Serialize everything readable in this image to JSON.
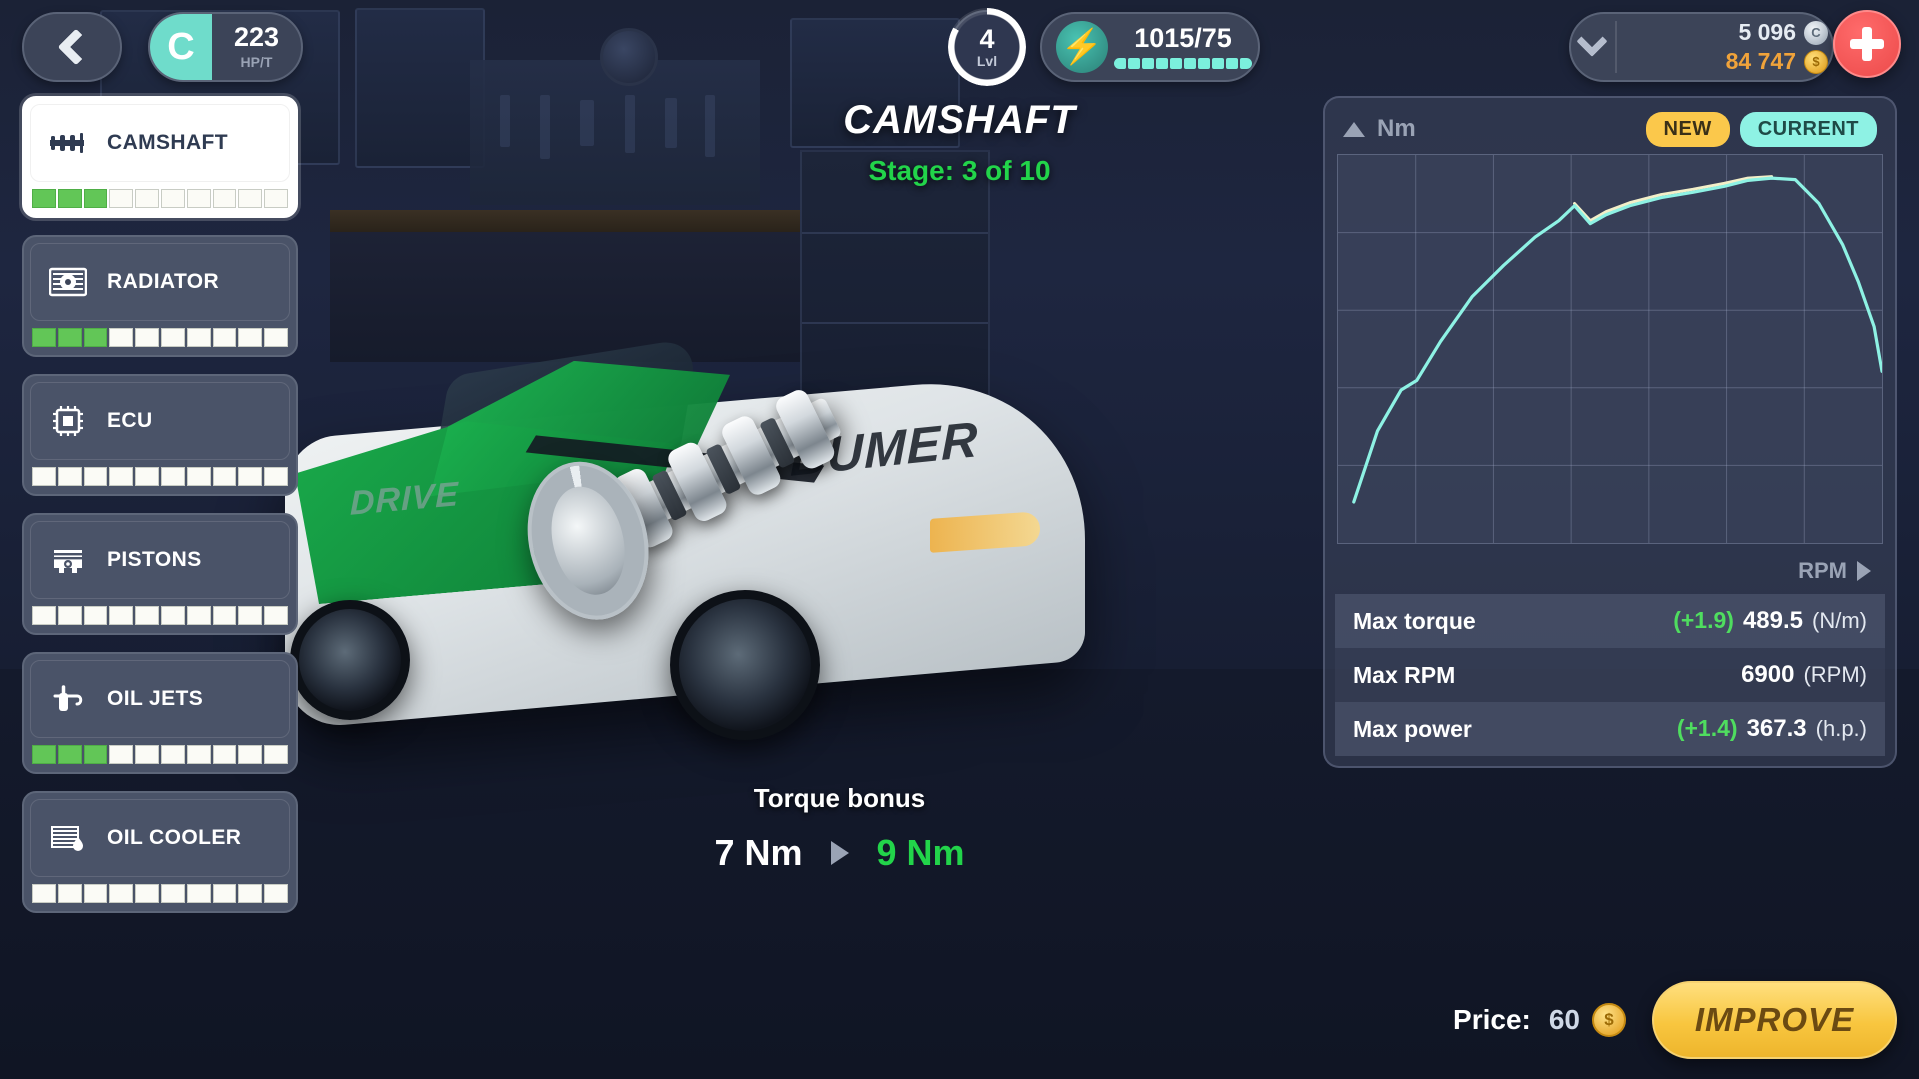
{
  "hud": {
    "back_icon": "chevron-left-icon",
    "class_letter": "C",
    "class_value": "223",
    "class_unit": "HP/T",
    "level_value": "4",
    "level_label": "Lvl",
    "energy_icon": "lightning-bolt-icon",
    "energy_value": "1015/75",
    "energy_segments_total": 10,
    "energy_segments_filled": 10,
    "silver_amount": "5 096",
    "gold_amount": "84 747",
    "add_icon": "plus-icon",
    "expand_icon": "chevron-down-icon"
  },
  "parts": [
    {
      "label": "CAMSHAFT",
      "icon": "camshaft-icon",
      "active": true,
      "level": 3,
      "max": 10
    },
    {
      "label": "RADIATOR",
      "icon": "radiator-icon",
      "active": false,
      "level": 3,
      "max": 10
    },
    {
      "label": "ECU",
      "icon": "ecu-chip-icon",
      "active": false,
      "level": 0,
      "max": 10
    },
    {
      "label": "PISTONS",
      "icon": "piston-icon",
      "active": false,
      "level": 0,
      "max": 10
    },
    {
      "label": "OIL JETS",
      "icon": "oil-jet-icon",
      "active": false,
      "level": 3,
      "max": 10
    },
    {
      "label": "OIL COOLER",
      "icon": "oil-cooler-icon",
      "active": false,
      "level": 0,
      "max": 10
    }
  ],
  "center": {
    "part_title": "CAMSHAFT",
    "stage_text": "Stage: 3 of 10",
    "bonus_label": "Torque bonus",
    "bonus_current": "7 Nm",
    "bonus_next": "9 Nm",
    "arrow_icon": "triangle-right-icon"
  },
  "chart_panel": {
    "y_axis_label": "Nm",
    "x_axis_label": "RPM",
    "axis_up_icon": "triangle-up-icon",
    "axis_right_icon": "triangle-right-icon",
    "badge_new": "NEW",
    "badge_current": "CURRENT",
    "stats": [
      {
        "name": "Max torque",
        "delta": "(+1.9)",
        "value": "489.5",
        "unit": "(N/m)"
      },
      {
        "name": "Max RPM",
        "delta": "",
        "value": "6900",
        "unit": "(RPM)"
      },
      {
        "name": "Max power",
        "delta": "(+1.4)",
        "value": "367.3",
        "unit": "(h.p.)"
      }
    ]
  },
  "chart_data": {
    "type": "line",
    "title": "",
    "xlabel": "RPM",
    "ylabel": "Nm",
    "grid": true,
    "grid_cols": 7,
    "grid_rows": 5,
    "legend_position": "top-right",
    "xlim": [
      0,
      6900
    ],
    "ylim": [
      0,
      520
    ],
    "series": [
      {
        "name": "CURRENT",
        "color": "#8ef2e4",
        "x": [
          200,
          500,
          800,
          1000,
          1300,
          1700,
          2100,
          2500,
          2800,
          3000,
          3200,
          3400,
          3700,
          4100,
          4500,
          4900,
          5200,
          5500,
          5800,
          6100,
          6400,
          6600,
          6800,
          6900
        ],
        "y": [
          55,
          150,
          205,
          218,
          270,
          330,
          372,
          410,
          432,
          452,
          428,
          440,
          452,
          463,
          470,
          478,
          486,
          489,
          487,
          455,
          400,
          350,
          290,
          230
        ]
      },
      {
        "name": "NEW",
        "color": "#f3efc8",
        "x": [
          3000,
          3200,
          3400,
          3700,
          4100,
          4500,
          4900,
          5200,
          5500
        ],
        "y": [
          455,
          432,
          444,
          456,
          467,
          474,
          482,
          489,
          491
        ]
      }
    ],
    "colors": {
      "accent_cyan": "#8ef2e4",
      "accent_yellow": "#fbc84b",
      "accent_green": "#22d44a",
      "accent_gold": "#f8c63f"
    }
  },
  "footer": {
    "price_label": "Price:",
    "price_value": "60",
    "coin_icon": "gold-coin-icon",
    "improve_label": "IMPROVE"
  }
}
